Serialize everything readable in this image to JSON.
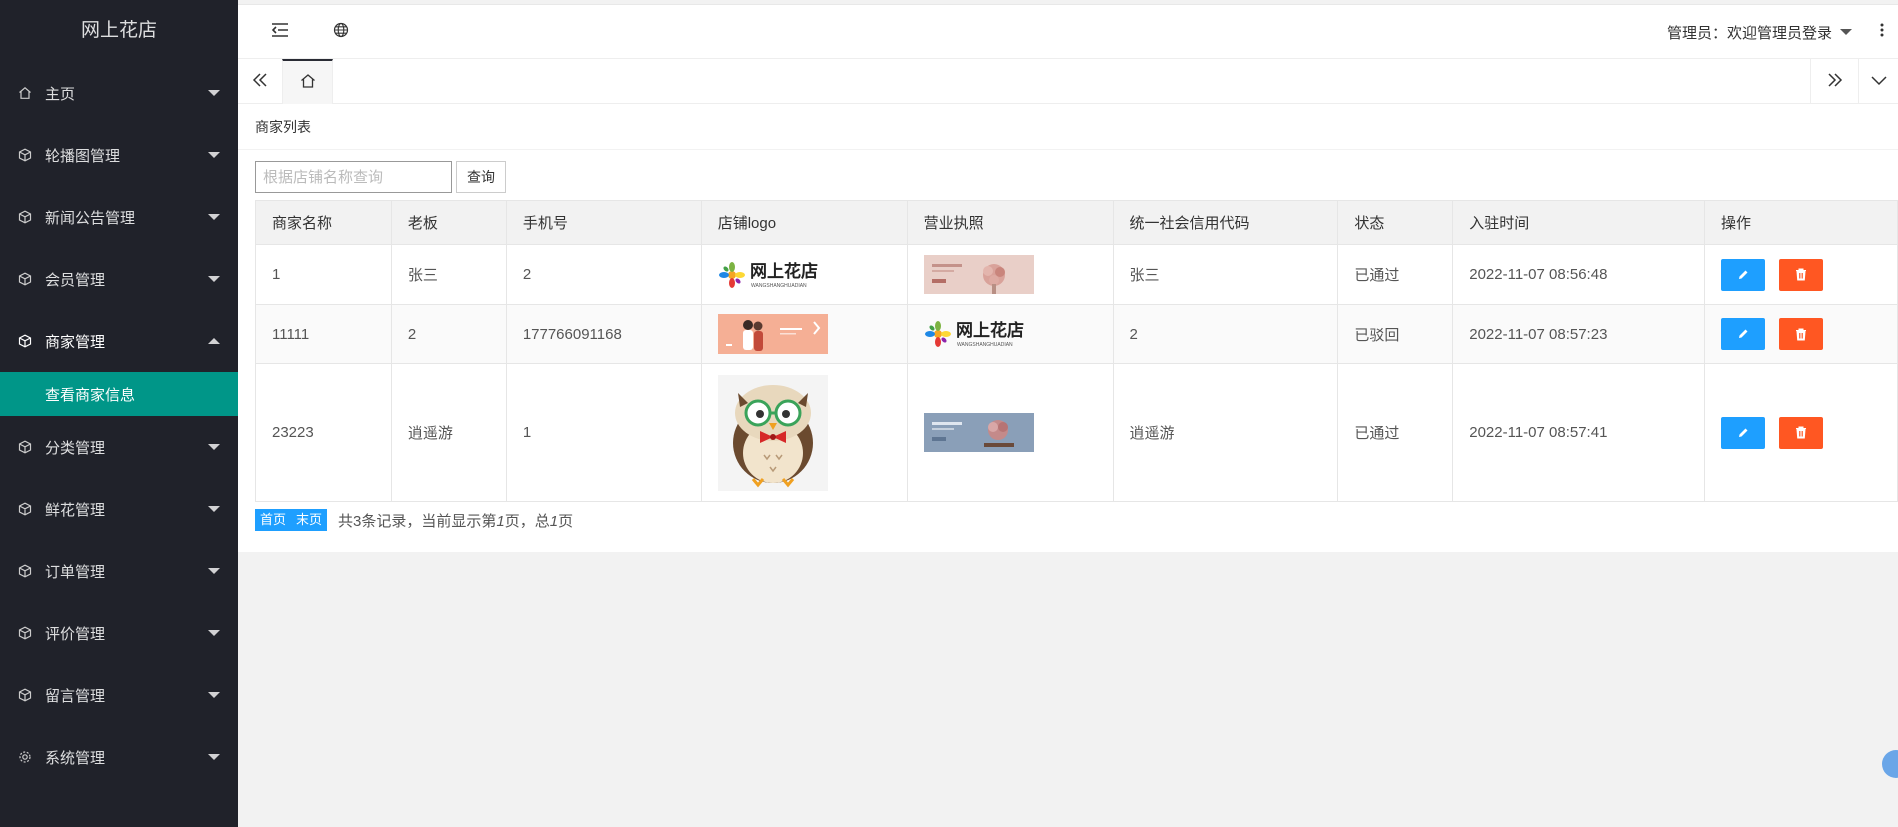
{
  "app_title": "网上花店",
  "sidebar": {
    "items": [
      {
        "label": "主页",
        "icon": "home-icon"
      },
      {
        "label": "轮播图管理",
        "icon": "cube-icon"
      },
      {
        "label": "新闻公告管理",
        "icon": "cube-icon"
      },
      {
        "label": "会员管理",
        "icon": "cube-icon"
      },
      {
        "label": "商家管理",
        "icon": "cube-icon",
        "expanded": true,
        "subitems": [
          {
            "label": "查看商家信息",
            "active": true
          }
        ]
      },
      {
        "label": "分类管理",
        "icon": "cube-icon"
      },
      {
        "label": "鲜花管理",
        "icon": "cube-icon"
      },
      {
        "label": "订单管理",
        "icon": "cube-icon"
      },
      {
        "label": "评价管理",
        "icon": "cube-icon"
      },
      {
        "label": "留言管理",
        "icon": "cube-icon"
      },
      {
        "label": "系统管理",
        "icon": "gear-icon"
      }
    ]
  },
  "header": {
    "user_label": "管理员：欢迎管理员登录"
  },
  "card": {
    "title": "商家列表",
    "search_placeholder": "根据店铺名称查询",
    "search_button": "查询"
  },
  "table": {
    "columns": [
      "商家名称",
      "老板",
      "手机号",
      "店铺logo",
      "营业执照",
      "统一社会信用代码",
      "状态",
      "入驻时间",
      "操作"
    ],
    "rows": [
      {
        "name": "1",
        "boss": "张三",
        "phone": "2",
        "logo": "flower-shop-logo",
        "license": "pink-flower-banner",
        "credit_code": "张三",
        "status": "已通过",
        "time": "2022-11-07 08:56:48"
      },
      {
        "name": "11111",
        "boss": "2",
        "phone": "177766091168",
        "logo": "couple-banner",
        "license": "flower-shop-logo",
        "credit_code": "2",
        "status": "已驳回",
        "time": "2022-11-07 08:57:23"
      },
      {
        "name": "23223",
        "boss": "逍遥游",
        "phone": "1",
        "logo": "owl-illustration",
        "license": "blue-flower-banner",
        "credit_code": "逍遥游",
        "status": "已通过",
        "time": "2022-11-07 08:57:41"
      }
    ]
  },
  "pager": {
    "first": "首页",
    "last": "末页",
    "info_prefix": "共3条记录，当前显示第",
    "current_page": "1",
    "info_mid": "页，总",
    "total_pages": "1",
    "info_suffix": "页"
  },
  "logo_text": {
    "cn": "网上花店",
    "en": "WANGSHANGHUADIAN"
  },
  "colors": {
    "sidebar_bg": "#20222a",
    "active_green": "#009688",
    "edit_blue": "#1e9fff",
    "delete_orange": "#ff5722"
  }
}
